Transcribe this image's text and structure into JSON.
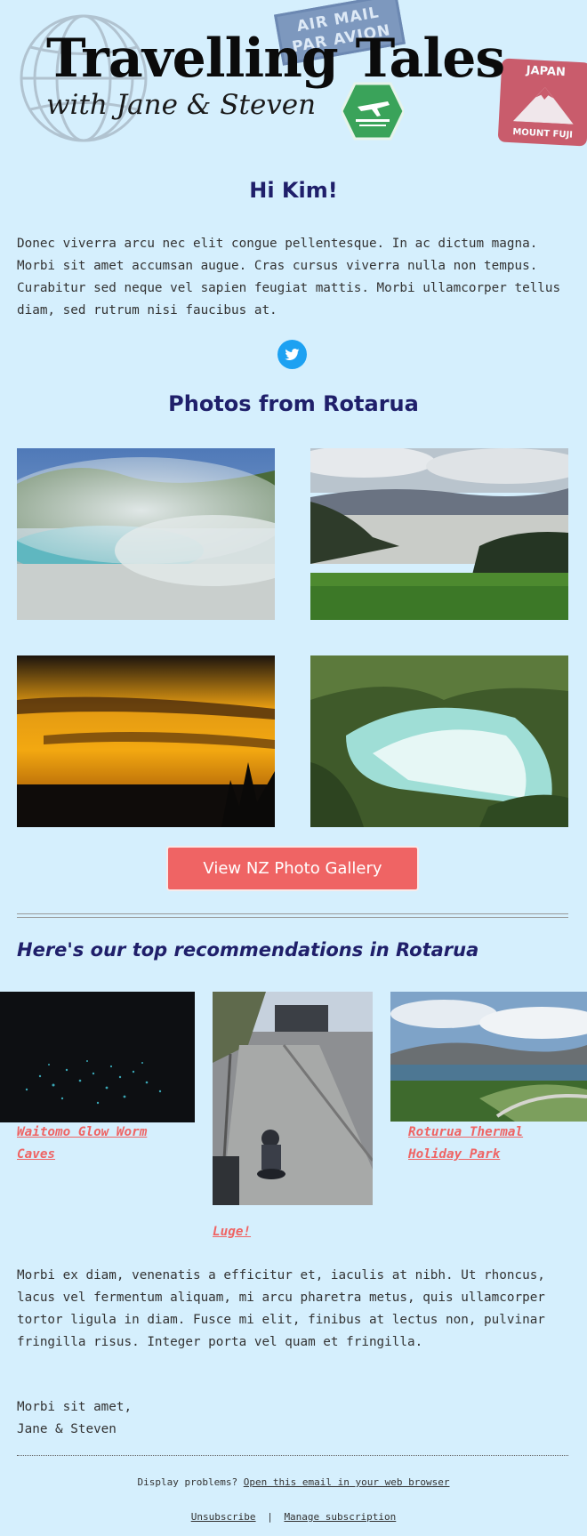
{
  "header": {
    "title": "Travelling Tales",
    "subtitle": "with Jane & Steven",
    "stamp_air_line1": "AIR MAIL",
    "stamp_air_line2": "PAR AVION",
    "stamp_japan_top": "JAPAN",
    "stamp_japan_bottom": "MOUNT FUJI"
  },
  "greeting": "Hi Kim!",
  "intro": "Donec viverra arcu nec elit congue pellentesque. In ac dictum magna. Morbi sit amet accumsan augue. Cras cursus viverra nulla non tempus. Curabitur sed neque vel sapien feugiat mattis. Morbi ullamcorper tellus diam, sed rutrum nisi faucibus at.",
  "photos_heading": "Photos from Rotarua",
  "gallery_button": "View NZ Photo Gallery",
  "recommendations_heading": "Here's our top recommendations in Rotarua",
  "recommendations": [
    {
      "label": "Waitomo Glow Worm Caves"
    },
    {
      "label": "Luge!"
    },
    {
      "label": "Roturua Thermal Holiday Park"
    }
  ],
  "body_text": "Morbi ex diam, venenatis a efficitur et, iaculis at nibh. Ut rhoncus, lacus vel fermentum aliquam, mi arcu pharetra metus, quis ullamcorper tortor ligula in diam. Fusce mi elit, finibus at lectus non, pulvinar fringilla risus. Integer porta vel quam et fringilla.",
  "signoff": {
    "line1": "Morbi sit amet,",
    "line2": "Jane & Steven"
  },
  "footer": {
    "display_problems": "Display problems?",
    "open_browser": "Open this email in your web browser",
    "unsubscribe": "Unsubscribe",
    "separator": "|",
    "manage": "Manage subscription"
  },
  "colors": {
    "background": "#d5effd",
    "heading": "#1f1f6a",
    "accent": "#ef6464",
    "twitter": "#1da1f2"
  },
  "icons": [
    "globe-icon",
    "twitter-icon"
  ]
}
